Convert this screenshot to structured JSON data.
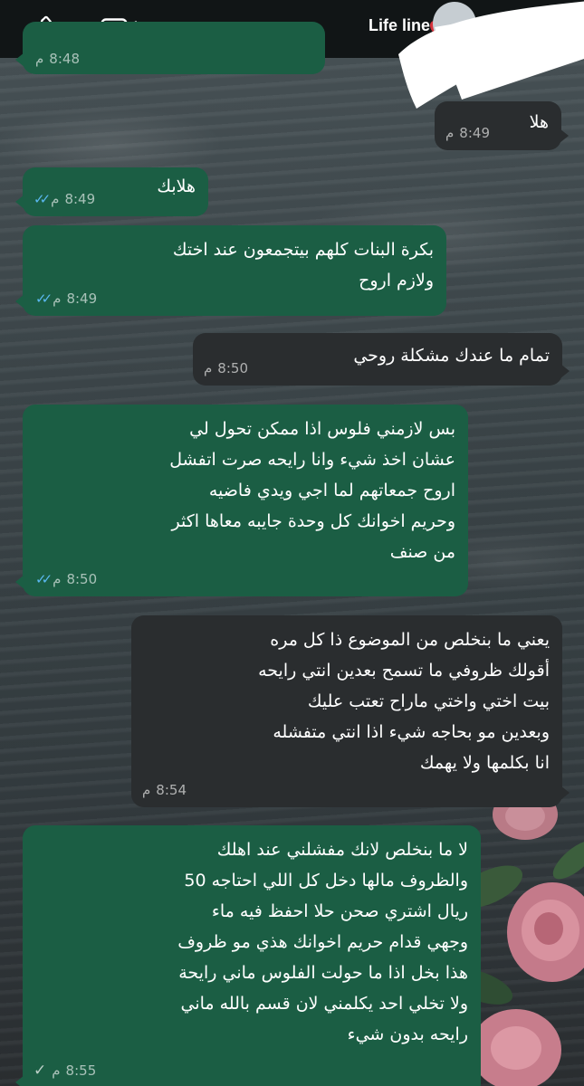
{
  "header": {
    "contact_name": "Life line",
    "contact_emoji": "anatomical-heart",
    "icons": [
      "phone-icon",
      "video-camera-icon"
    ]
  },
  "colors": {
    "outgoing_bubble": "#1b5e44",
    "incoming_bubble": "#2a2d2f",
    "header_bg": "#111516",
    "read_ticks": "#5ab8f0"
  },
  "messages": [
    {
      "text": "",
      "time": "8:48",
      "period": "م",
      "direction": "out",
      "status": ""
    },
    {
      "text": "هلا",
      "time": "8:49",
      "period": "م",
      "direction": "in",
      "status": ""
    },
    {
      "text": "هلابك",
      "time": "8:49",
      "period": "م",
      "direction": "out",
      "status": "read"
    },
    {
      "text": "بكرة البنات كلهم بيتجمعون عند اختك\nولازم اروح",
      "time": "8:49",
      "period": "م",
      "direction": "out",
      "status": "read"
    },
    {
      "text": "تمام ما عندك مشكلة روحي",
      "time": "8:50",
      "period": "م",
      "direction": "in",
      "status": ""
    },
    {
      "text": "بس لازمني فلوس اذا ممكن تحول لي\nعشان اخذ شيء وانا رايحه صرت اتفشل\nاروح جمعاتهم لما اجي ويدي فاضيه\nوحريم اخوانك كل وحدة جايبه معاها اكثر\nمن صنف",
      "time": "8:50",
      "period": "م",
      "direction": "out",
      "status": "read"
    },
    {
      "text": "يعني ما بنخلص من الموضوع ذا كل مره\nأقولك ظروفي ما تسمح بعدين انتي رايحه\nبيت اختي واختي ماراح تعتب عليك\nوبعدين مو بحاجه شيء  اذا انتي متفشله\nانا بكلمها ولا يهمك",
      "time": "8:54",
      "period": "م",
      "direction": "in",
      "status": ""
    },
    {
      "text": "لا ما بنخلص لانك مفشلني عند اهلك\nوالظروف مالها دخل كل اللي احتاجه 50\nريال اشتري صحن حلا احفظ فيه ماء\nوجهي قدام حريم اخوانك هذي مو ظروف\nهذا بخل اذا ما حولت الفلوس ماني رايحة\nولا تخلي احد يكلمني لان قسم بالله ماني\nرايحه بدون شيء",
      "time": "8:55",
      "period": "م",
      "direction": "out",
      "status": "sent"
    }
  ]
}
